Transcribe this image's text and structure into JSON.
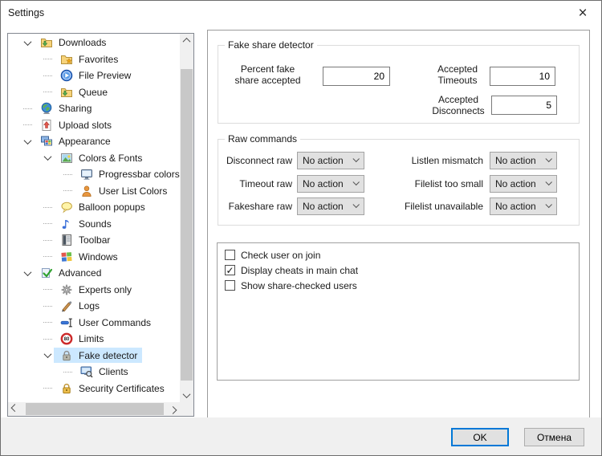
{
  "window": {
    "title": "Settings"
  },
  "tree": {
    "items": [
      {
        "label": "Downloads",
        "level": 0,
        "expanded": true,
        "icon": "folder-download-icon",
        "selected": false
      },
      {
        "label": "Favorites",
        "level": 1,
        "expanded": false,
        "icon": "folder-star-icon",
        "selected": false
      },
      {
        "label": "File Preview",
        "level": 1,
        "expanded": false,
        "icon": "play-circle-icon",
        "selected": false
      },
      {
        "label": "Queue",
        "level": 1,
        "expanded": false,
        "icon": "folder-download-icon",
        "selected": false
      },
      {
        "label": "Sharing",
        "level": 0,
        "expanded": false,
        "icon": "globe-icon",
        "selected": false
      },
      {
        "label": "Upload slots",
        "level": 0,
        "expanded": false,
        "icon": "upload-page-icon",
        "selected": false
      },
      {
        "label": "Appearance",
        "level": 0,
        "expanded": true,
        "icon": "monitors-icon",
        "selected": false
      },
      {
        "label": "Colors & Fonts",
        "level": 1,
        "expanded": true,
        "icon": "picture-icon",
        "selected": false
      },
      {
        "label": "Progressbar colors",
        "level": 2,
        "expanded": false,
        "icon": "monitor-icon",
        "selected": false
      },
      {
        "label": "User List Colors",
        "level": 2,
        "expanded": false,
        "icon": "person-icon",
        "selected": false
      },
      {
        "label": "Balloon popups",
        "level": 1,
        "expanded": false,
        "icon": "balloon-icon",
        "selected": false
      },
      {
        "label": "Sounds",
        "level": 1,
        "expanded": false,
        "icon": "music-note-icon",
        "selected": false
      },
      {
        "label": "Toolbar",
        "level": 1,
        "expanded": false,
        "icon": "toolbar-icon",
        "selected": false
      },
      {
        "label": "Windows",
        "level": 1,
        "expanded": false,
        "icon": "windows-logo-icon",
        "selected": false
      },
      {
        "label": "Advanced",
        "level": 0,
        "expanded": true,
        "icon": "check-page-icon",
        "selected": false
      },
      {
        "label": "Experts only",
        "level": 1,
        "expanded": false,
        "icon": "gear-icon",
        "selected": false
      },
      {
        "label": "Logs",
        "level": 1,
        "expanded": false,
        "icon": "pen-icon",
        "selected": false
      },
      {
        "label": "User Commands",
        "level": 1,
        "expanded": false,
        "icon": "ibeam-icon",
        "selected": false
      },
      {
        "label": "Limits",
        "level": 1,
        "expanded": false,
        "icon": "limit-sign-icon",
        "selected": false
      },
      {
        "label": "Fake detector",
        "level": 1,
        "expanded": true,
        "icon": "lock-gray-icon",
        "selected": true
      },
      {
        "label": "Clients",
        "level": 2,
        "expanded": false,
        "icon": "monitor-search-icon",
        "selected": false
      },
      {
        "label": "Security Certificates",
        "level": 1,
        "expanded": false,
        "icon": "lock-gold-icon",
        "selected": false
      }
    ]
  },
  "fake_share": {
    "title": "Fake share detector",
    "fields": [
      {
        "label": "Percent fake share accepted",
        "value": "20"
      },
      {
        "label": "Accepted Timeouts",
        "value": "10"
      },
      {
        "label": "Accepted Disconnects",
        "value": "5"
      }
    ]
  },
  "raw_commands": {
    "title": "Raw commands",
    "rows": [
      {
        "label": "Disconnect raw",
        "value": "No action"
      },
      {
        "label": "Timeout raw",
        "value": "No action"
      },
      {
        "label": "Fakeshare raw",
        "value": "No action"
      },
      {
        "label": "Listlen mismatch",
        "value": "No action"
      },
      {
        "label": "Filelist too small",
        "value": "No action"
      },
      {
        "label": "Filelist unavailable",
        "value": "No action"
      }
    ]
  },
  "checks": {
    "items": [
      {
        "label": "Check user on join",
        "checked": false
      },
      {
        "label": "Display cheats in main chat",
        "checked": true
      },
      {
        "label": "Show share-checked users",
        "checked": false
      }
    ]
  },
  "footer": {
    "ok_label": "OK",
    "cancel_label": "Отмена"
  },
  "colors": {
    "accent": "#0078d7",
    "selection": "#cce8ff",
    "combo_bg": "#e1e1e1",
    "footer_bg": "#f0f0f0"
  }
}
